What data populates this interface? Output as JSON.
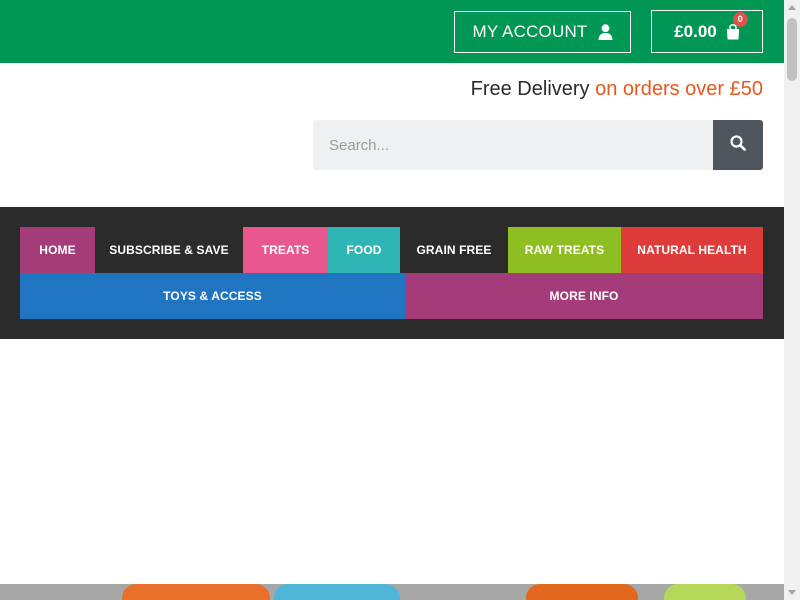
{
  "header": {
    "account_label": "MY ACCOUNT",
    "account_icon": "user-icon",
    "cart_total": "£0.00",
    "cart_icon": "shopping-bag-icon",
    "cart_count": "0",
    "bg_color": "#009654"
  },
  "delivery": {
    "text_main": "Free Delivery",
    "text_accent": "on orders over £50",
    "accent_color": "#e8571e"
  },
  "search": {
    "placeholder": "Search...",
    "icon": "search-icon"
  },
  "nav": {
    "items": [
      {
        "label": "HOME",
        "color": "#a33c78"
      },
      {
        "label": "SUBSCRIBE & SAVE",
        "color": "#2b2b2b"
      },
      {
        "label": "TREATS",
        "color": "#e8588e"
      },
      {
        "label": "FOOD",
        "color": "#2fb5b3"
      },
      {
        "label": "GRAIN FREE",
        "color": "#2b2b2b"
      },
      {
        "label": "RAW TREATS",
        "color": "#8fbe22"
      },
      {
        "label": "NATURAL HEALTH",
        "color": "#de3b3b"
      },
      {
        "label": "TOYS & ACCESS",
        "color": "#1f75c2"
      },
      {
        "label": "MORE INFO",
        "color": "#a33c78"
      }
    ]
  }
}
